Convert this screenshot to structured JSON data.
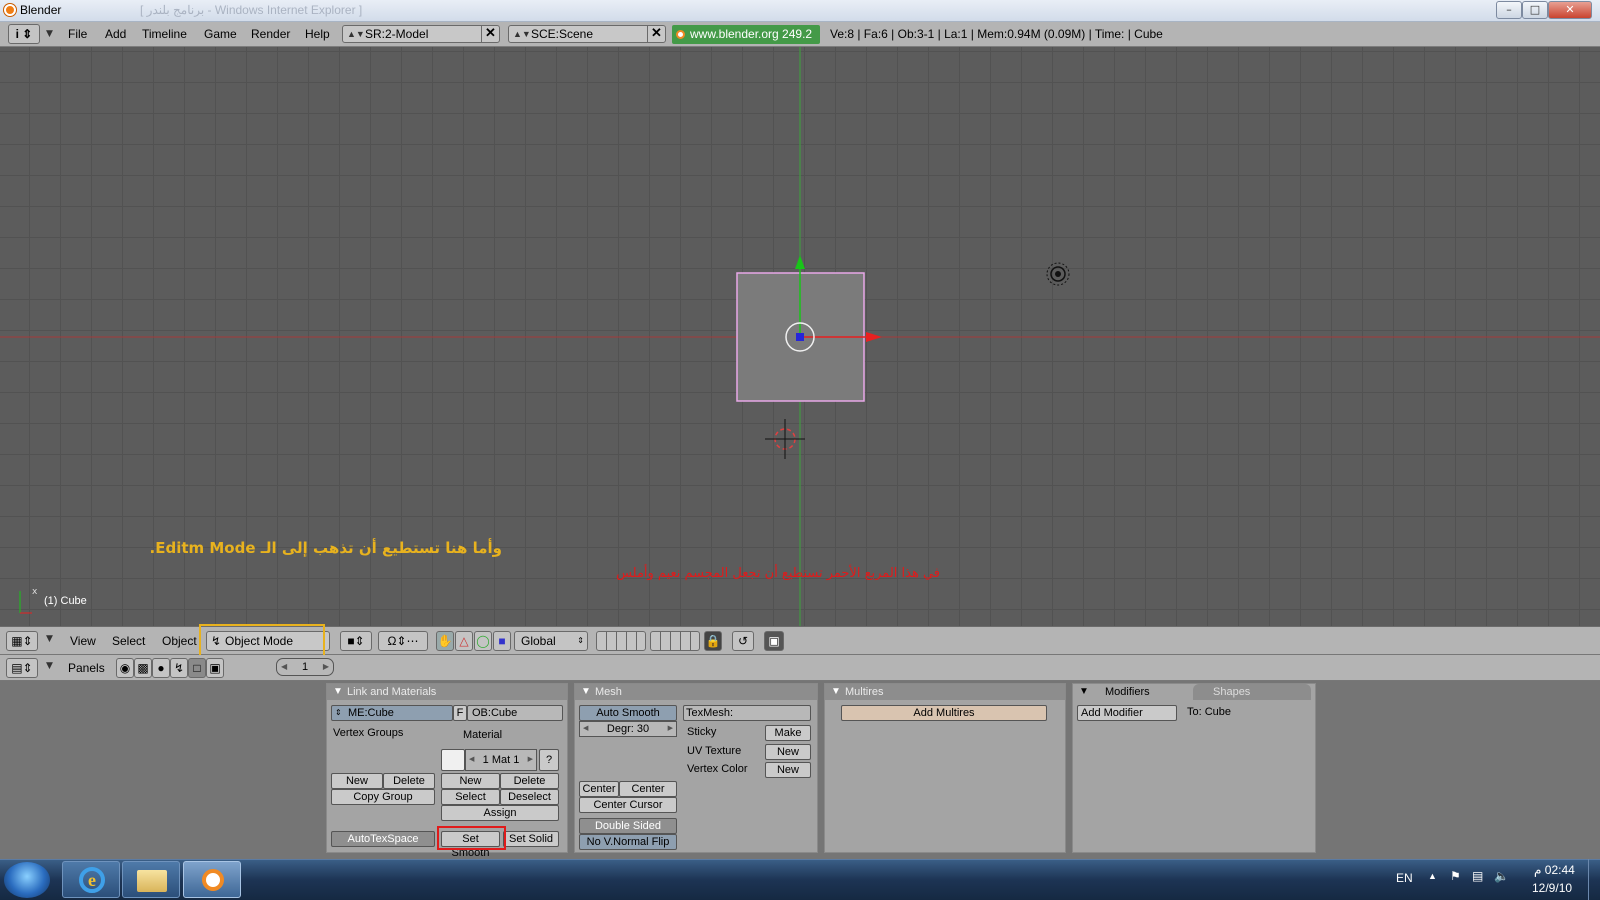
{
  "window": {
    "title": "Blender",
    "subtitle": "[ برنامج بلندر - Windows Internet Explorer ]"
  },
  "menu": {
    "items": [
      "File",
      "Add",
      "Timeline",
      "Game",
      "Render",
      "Help"
    ]
  },
  "screen_field": "SR:2-Model",
  "scene_field": "SCE:Scene",
  "url_label": "www.blender.org 249.2",
  "stats": "Ve:8 | Fa:6 | Ob:3-1 | La:1  | Mem:0.94M (0.09M)  | Time: | Cube",
  "viewport": {
    "object_label": "(1) Cube",
    "axis_x": "x",
    "note_yellow": "وأما هنا تستطيع أن تذهب إلى الـ Editm Mode.",
    "note_red": "في هذا المربع الأحمر تستطيع أن تجعل المجسم نعيم وأملس"
  },
  "view3d_header": {
    "view": "View",
    "select": "Select",
    "object": "Object",
    "mode": "Object Mode",
    "orientation": "Global"
  },
  "buttons_header": {
    "panels": "Panels",
    "frame": "1"
  },
  "link_materials": {
    "title": "Link and Materials",
    "me_field": "ME:Cube",
    "f_label": "F",
    "ob_field": "OB:Cube",
    "vertex_groups": "Vertex Groups",
    "material": "Material",
    "mat_field": "1 Mat 1",
    "help": "?",
    "vg_new": "New",
    "vg_delete": "Delete",
    "copy_group": "Copy Group",
    "mat_new": "New",
    "mat_delete": "Delete",
    "mat_select": "Select",
    "mat_deselect": "Deselect",
    "assign": "Assign",
    "autotexspace": "AutoTexSpace",
    "set_smooth": "Set Smooth",
    "set_solid": "Set Solid"
  },
  "mesh": {
    "title": "Mesh",
    "auto_smooth": "Auto Smooth",
    "degr": "Degr: 30",
    "texmesh": "TexMesh:",
    "sticky": "Sticky",
    "make": "Make",
    "uv_texture": "UV Texture",
    "uv_new": "New",
    "vertex_color": "Vertex Color",
    "vc_new": "New",
    "center": "Center",
    "center_new": "Center New",
    "center_cursor": "Center Cursor",
    "double_sided": "Double Sided",
    "no_vnormal_flip": "No V.Normal Flip"
  },
  "multires": {
    "title": "Multires",
    "add_multires": "Add Multires"
  },
  "modifiers": {
    "tab_modifiers": "Modifiers",
    "tab_shapes": "Shapes",
    "add_modifier": "Add Modifier",
    "to_label": "To: Cube"
  },
  "taskbar": {
    "lang": "EN",
    "time": "02:44 م",
    "date": "12/9/10"
  },
  "colors": {
    "annotation_yellow": "#e8b21e",
    "annotation_red": "#e01b1b",
    "grid": "#5c5c5c",
    "panel": "#a4a4a4"
  }
}
